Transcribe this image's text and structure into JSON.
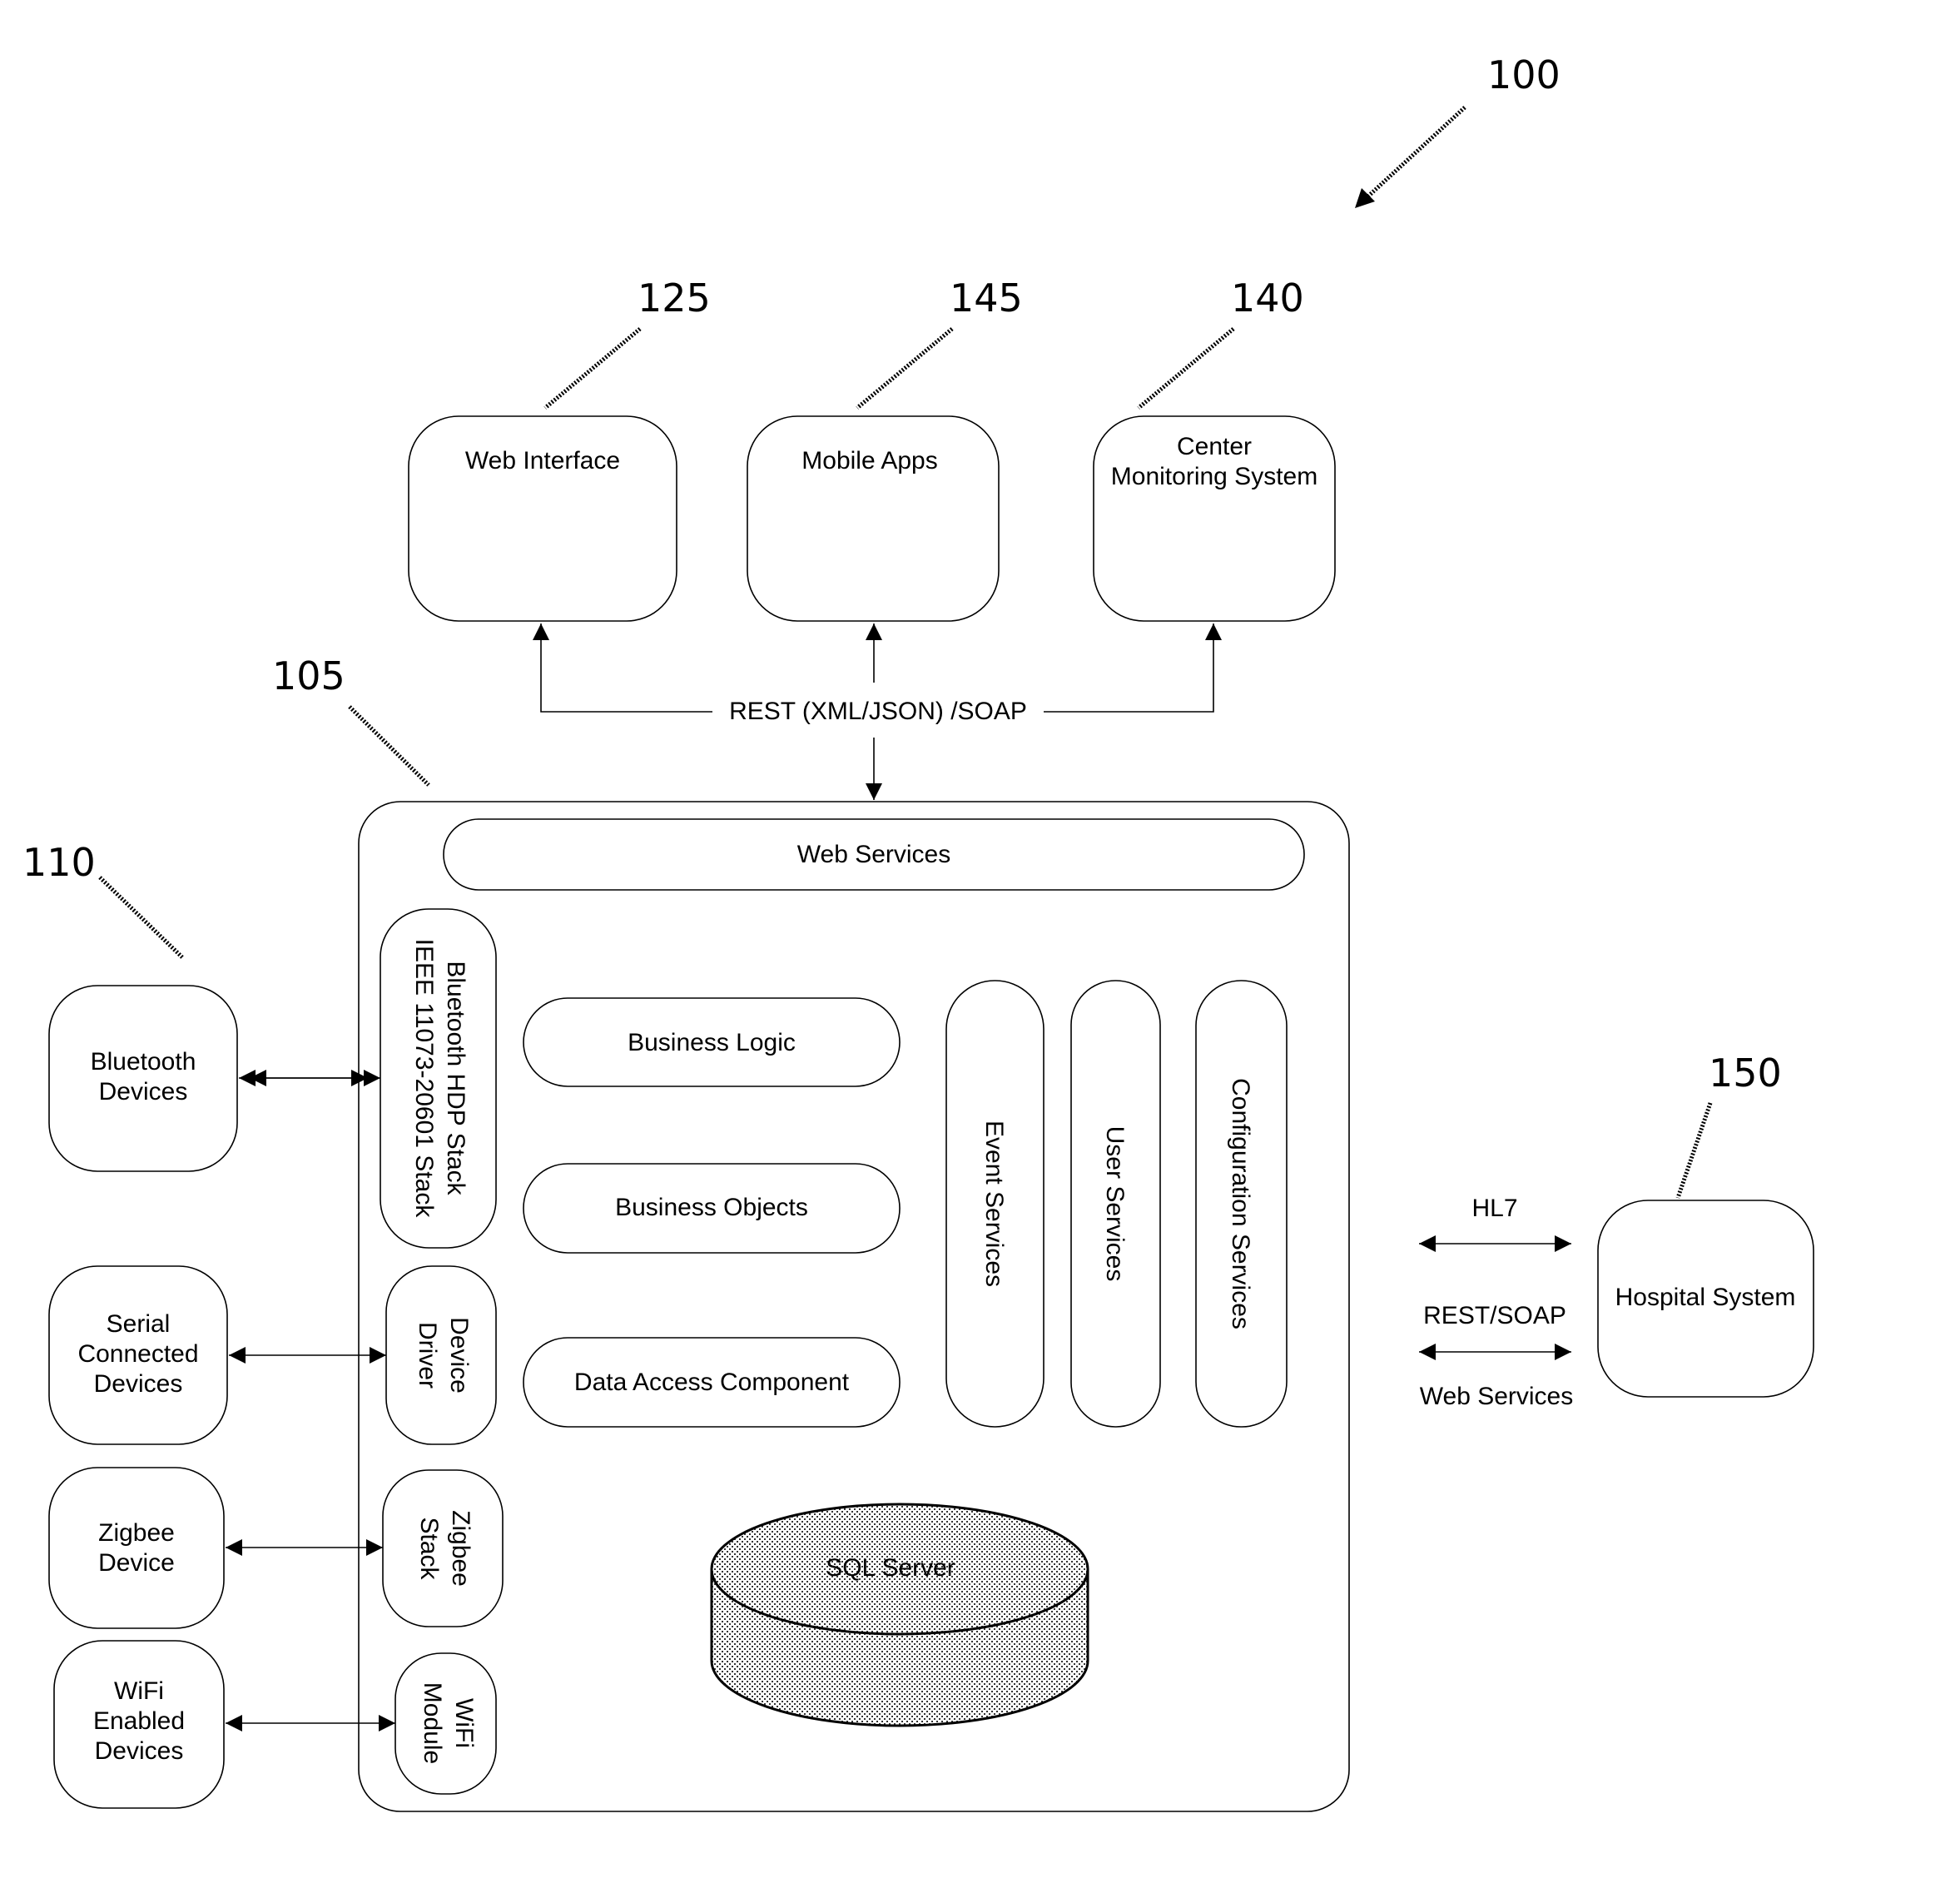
{
  "figure": {
    "ref_system": "100",
    "top": {
      "web_interface": {
        "ref": "125",
        "label": "Web Interface"
      },
      "mobile_apps": {
        "ref": "145",
        "label": "Mobile Apps"
      },
      "center_monitoring": {
        "ref": "140",
        "label_line1": "Center",
        "label_line2": "Monitoring System"
      },
      "protocol_label": "REST (XML/JSON) /SOAP"
    },
    "server": {
      "ref": "105",
      "web_services": "Web Services",
      "bluetooth_stack_line1": "Bluetooth HDP Stack",
      "bluetooth_stack_line2": "IEEE 11073-20601 Stack",
      "device_driver_line1": "Device",
      "device_driver_line2": "Driver",
      "zigbee_stack_line1": "Zigbee",
      "zigbee_stack_line2": "Stack",
      "wifi_module_line1": "WiFi",
      "wifi_module_line2": "Module",
      "business_logic": "Business Logic",
      "business_objects": "Business Objects",
      "data_access": "Data Access Component",
      "event_services": "Event Services",
      "user_services": "User Services",
      "configuration_services": "Configuration Services",
      "sql_server": "SQL Server"
    },
    "devices": {
      "ref": "110",
      "bluetooth_line1": "Bluetooth",
      "bluetooth_line2": "Devices",
      "serial_line1": "Serial",
      "serial_line2": "Connected",
      "serial_line3": "Devices",
      "zigbee_line1": "Zigbee",
      "zigbee_line2": "Device",
      "wifi_line1": "WiFi",
      "wifi_line2": "Enabled",
      "wifi_line3": "Devices"
    },
    "hospital": {
      "ref": "150",
      "label": "Hospital System",
      "hl7_label": "HL7",
      "rest_soap_label": "REST/SOAP",
      "web_services_label": "Web Services"
    }
  }
}
